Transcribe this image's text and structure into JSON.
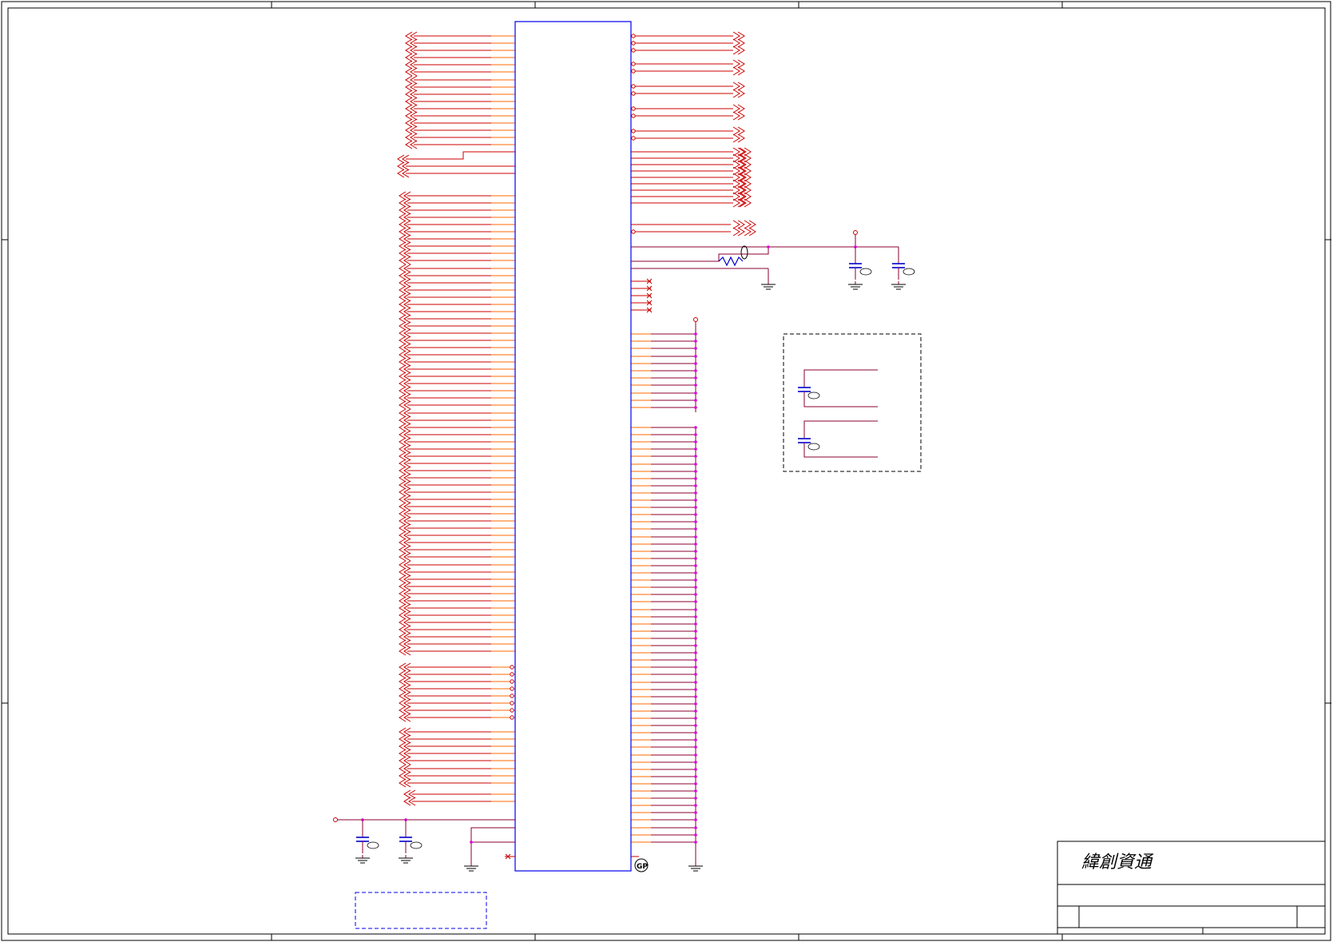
{
  "title_block": {
    "company": "緯創資通"
  },
  "symbols": {
    "gp_label": "GP"
  },
  "colors": {
    "wire": "#cc0000",
    "net": "#8b0032",
    "body": "#0000ee",
    "junction": "#dd00dd",
    "cap": "#0000cc",
    "frame": "#000000"
  }
}
